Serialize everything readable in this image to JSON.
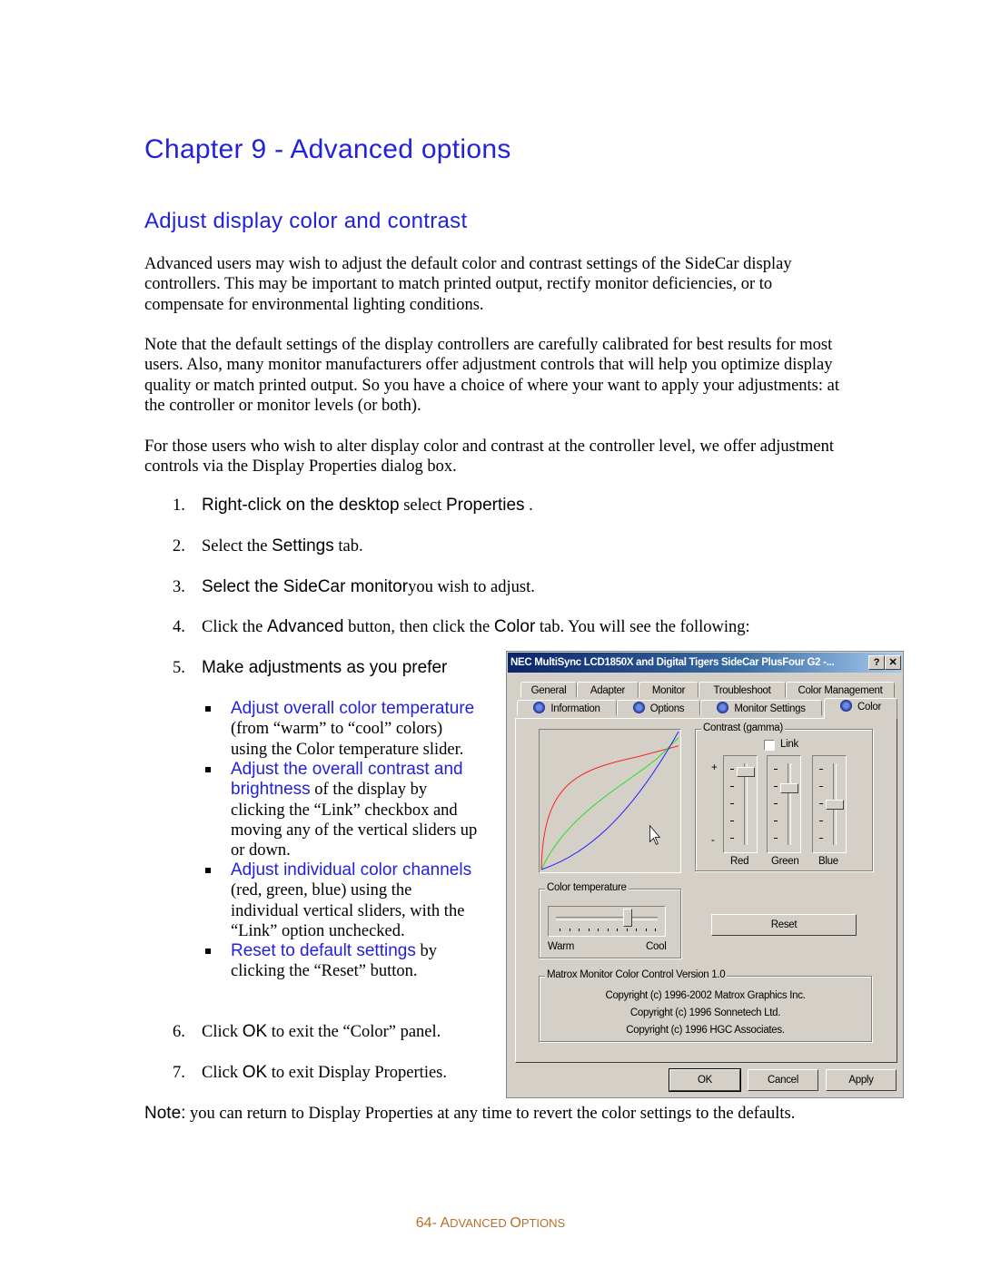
{
  "chapter_title": "Chapter 9 - Advanced options",
  "section_title": "Adjust display color and contrast",
  "paragraphs": [
    "Advanced users may wish to adjust the default color and contrast settings of the SideCar display controllers. This may be important to match printed output, rectify monitor deficiencies, or to compensate for environmental lighting conditions.",
    "Note that the default settings of the display controllers are carefully calibrated for best results for most users. Also, many monitor manufacturers offer adjustment controls that will help you optimize display quality or match printed output. So you have a choice of where your want to apply your adjustments: at the controller or monitor levels (or both).",
    "For those users who wish to alter display color and contrast at the controller level, we offer adjustment controls via the Display Properties dialog box."
  ],
  "steps": [
    {
      "num": "1.",
      "a": "Right-click on the desktop",
      "b": " select ",
      "c": "Properties",
      "d": " ."
    },
    {
      "num": "2.",
      "a": "Select the ",
      "b": "Settings",
      "c": " tab."
    },
    {
      "num": "3.",
      "a": "Select the SideCar monitor",
      "b": "you wish to adjust."
    },
    {
      "num": "4.",
      "a": "Click the ",
      "b": "Advanced",
      "c": " button, then click the ",
      "d": "Color",
      "e": " tab. You will see the following:"
    },
    {
      "num": "5.",
      "a": "Make adjustments as you prefer"
    },
    {
      "num": "6.",
      "a": "Click ",
      "b": "OK",
      "c": " to exit the “Color” panel."
    },
    {
      "num": "7.",
      "a": "Click ",
      "b": "OK",
      "c": " to exit Display Properties."
    }
  ],
  "bullets": [
    {
      "link": "Adjust overall color temperature",
      "text": " (from “warm” to “cool” colors) using the Color temperature slider."
    },
    {
      "link": "Adjust the overall contrast and brightness",
      "text": " of the display by clicking the “Link” checkbox and moving any of the vertical sliders up or down."
    },
    {
      "link": "Adjust individual color channels",
      "text": " (red, green, blue) using the individual vertical sliders, with the “Link” option unchecked."
    },
    {
      "link": "Reset to default settings",
      "text": " by clicking the “Reset” button."
    }
  ],
  "note": {
    "label": "Note:",
    "text": " you can return to Display Properties at any time to revert the color settings to the defaults."
  },
  "footer": {
    "page": "64",
    "sep": "- ",
    "a": "A",
    "b": "DVANCED ",
    "c": "O",
    "d": "PTIONS"
  },
  "dialog": {
    "title": "NEC MultiSync LCD1850X and Digital Tigers SideCar PlusFour G2 -...",
    "help": "?",
    "close": "✕",
    "tabs_row1": [
      "General",
      "Adapter",
      "Monitor",
      "Troubleshoot",
      "Color Management"
    ],
    "tabs_row2": [
      "Information",
      "Options",
      "Monitor Settings",
      "Color"
    ],
    "active_tab": "Color",
    "contrast_label": "Contrast (gamma)",
    "link_label": "Link",
    "link_checked": false,
    "plus": "+",
    "minus": "-",
    "sliders": [
      {
        "label": "Red",
        "level_percent": 95
      },
      {
        "label": "Green",
        "level_percent": 72
      },
      {
        "label": "Blue",
        "level_percent": 50
      }
    ],
    "color_temperature": {
      "label": "Color temperature",
      "warm": "Warm",
      "cool": "Cool",
      "level_percent": 75
    },
    "reset": "Reset",
    "about_label": "Matrox Monitor Color Control Version 1.0",
    "copyright": [
      "Copyright (c) 1996-2002 Matrox Graphics Inc.",
      "Copyright (c) 1996 Sonnetech Ltd.",
      "Copyright (c) 1996 HGC Associates."
    ],
    "ok": "OK",
    "cancel": "Cancel",
    "apply": "Apply",
    "curve_colors": {
      "red": "#ff2020",
      "green": "#20e020",
      "blue": "#2020ff"
    }
  }
}
